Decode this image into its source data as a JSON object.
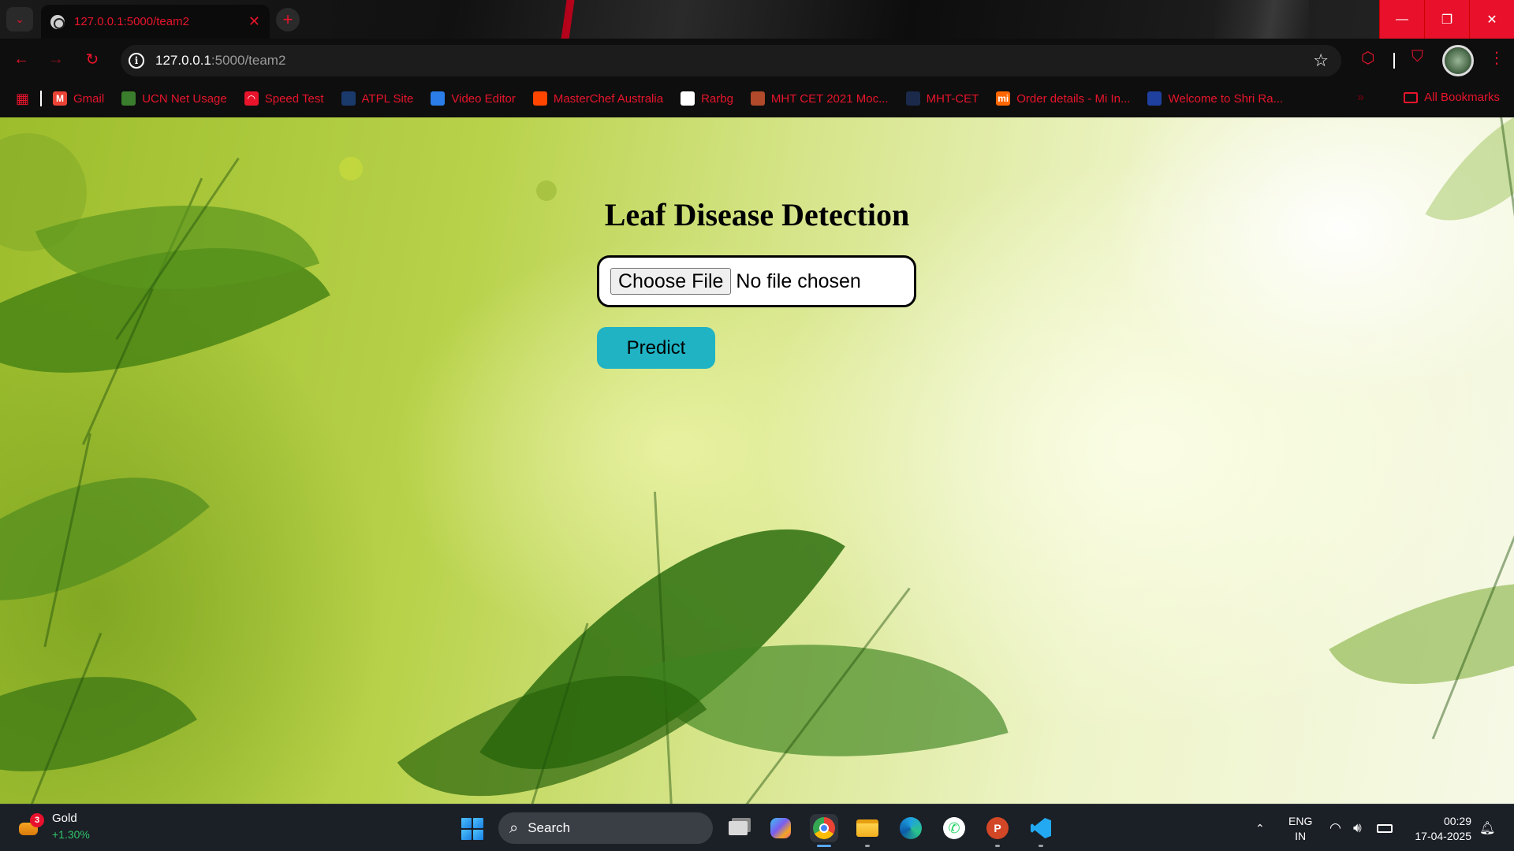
{
  "browser": {
    "tab": {
      "title": "127.0.0.1:5000/team2",
      "close_label": "✕"
    },
    "new_tab_label": "+",
    "address": {
      "host": "127.0.0.1",
      "path": ":5000/team2"
    },
    "window_controls": {
      "minimize": "—",
      "restore": "❐",
      "close": "✕"
    },
    "bookmarks": [
      {
        "label": "Gmail",
        "icon": "gmail-icon",
        "color": "#ea4335",
        "glyph": "M"
      },
      {
        "label": "UCN Net Usage",
        "icon": "ucn-icon",
        "color": "#3a7d2c",
        "glyph": ""
      },
      {
        "label": "Speed Test",
        "icon": "speedtest-icon",
        "color": "#e8142c",
        "glyph": "◠"
      },
      {
        "label": "ATPL Site",
        "icon": "atpl-icon",
        "color": "#1a3a6b",
        "glyph": ""
      },
      {
        "label": "Video Editor",
        "icon": "video-editor-icon",
        "color": "#2b7de9",
        "glyph": ""
      },
      {
        "label": "MasterChef Australia",
        "icon": "reddit-icon",
        "color": "#ff4500",
        "glyph": ""
      },
      {
        "label": "Rarbg",
        "icon": "rarbg-icon",
        "color": "#ffffff",
        "glyph": ""
      },
      {
        "label": "MHT CET 2021 Moc...",
        "icon": "mhtcet-icon",
        "color": "#b04a2a",
        "glyph": ""
      },
      {
        "label": "MHT-CET",
        "icon": "mhtcet-doc-icon",
        "color": "#1b2a4a",
        "glyph": ""
      },
      {
        "label": "Order details - Mi In...",
        "icon": "mi-icon",
        "color": "#ff6700",
        "glyph": "mi"
      },
      {
        "label": "Welcome to Shri Ra...",
        "icon": "shri-icon",
        "color": "#2040a0",
        "glyph": ""
      }
    ],
    "all_bookmarks_label": "All Bookmarks"
  },
  "page": {
    "title": "Leaf Disease Detection",
    "file_input": {
      "button_label": "Choose File",
      "status": "No file chosen"
    },
    "predict_label": "Predict"
  },
  "taskbar": {
    "widget": {
      "badge": "3",
      "name": "Gold",
      "value": "+1.30%"
    },
    "search_placeholder": "Search",
    "language": {
      "line1": "ENG",
      "line2": "IN"
    },
    "clock": {
      "time": "00:29",
      "date": "17-04-2025"
    }
  }
}
